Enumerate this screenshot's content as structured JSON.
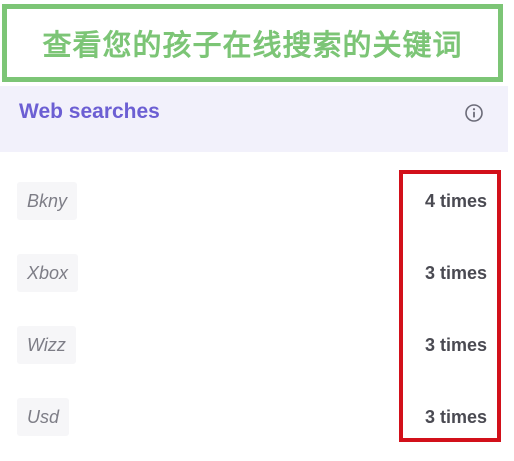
{
  "banner": {
    "text": "查看您的孩子在线搜索的关键词",
    "color": "#7cc576"
  },
  "card": {
    "title": "Web searches",
    "title_color": "#6c5fd3",
    "header_background": "#f2f1fb",
    "info_icon": "info-circle-icon"
  },
  "searches": [
    {
      "term": "Bkny",
      "count": "4 times"
    },
    {
      "term": "Xbox",
      "count": "3 times"
    },
    {
      "term": "Wizz",
      "count": "3 times"
    },
    {
      "term": "Usd",
      "count": "3 times"
    }
  ],
  "highlight": {
    "color": "#d2101a"
  }
}
